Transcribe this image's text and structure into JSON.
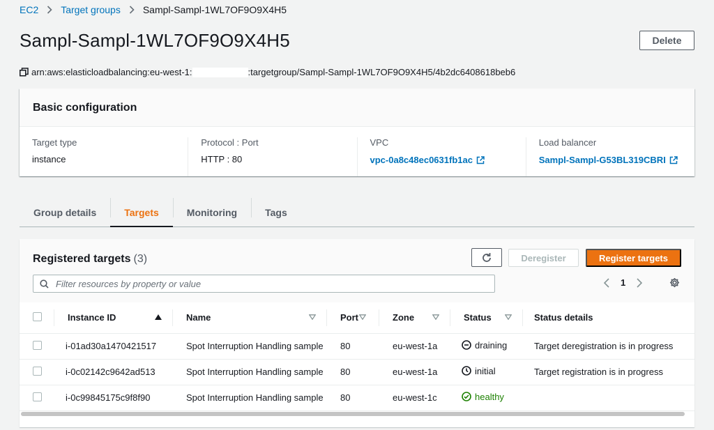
{
  "breadcrumb": {
    "ec2": "EC2",
    "target_groups": "Target groups",
    "current": "Sampl-Sampl-1WL7OF9O9X4H5"
  },
  "page": {
    "title": "Sampl-Sampl-1WL7OF9O9X4H5",
    "delete_label": "Delete",
    "arn_prefix": "arn:aws:elasticloadbalancing:eu-west-1:",
    "arn_suffix": ":targetgroup/Sampl-Sampl-1WL7OF9O9X4H5/4b2dc6408618beb6"
  },
  "basic_config": {
    "title": "Basic configuration",
    "target_type_label": "Target type",
    "target_type": "instance",
    "protocol_label": "Protocol : Port",
    "protocol": "HTTP : 80",
    "vpc_label": "VPC",
    "vpc": "vpc-0a8c48ec0631fb1ac",
    "lb_label": "Load balancer",
    "lb": "Sampl-Sampl-G53BL319CBRI"
  },
  "tabs": [
    "Group details",
    "Targets",
    "Monitoring",
    "Tags"
  ],
  "targets": {
    "title": "Registered targets",
    "count": "(3)",
    "deregister_label": "Deregister",
    "register_label": "Register targets",
    "filter_placeholder": "Filter resources by property or value",
    "page": "1",
    "columns": {
      "instance_id": "Instance ID",
      "name": "Name",
      "port": "Port",
      "zone": "Zone",
      "status": "Status",
      "status_details": "Status details"
    },
    "rows": [
      {
        "instance_id": "i-01ad30a1470421517",
        "name": "Spot Interruption Handling sample",
        "port": "80",
        "zone": "eu-west-1a",
        "status": "draining",
        "details": "Target deregistration is in progress"
      },
      {
        "instance_id": "i-0c02142c9642ad513",
        "name": "Spot Interruption Handling sample",
        "port": "80",
        "zone": "eu-west-1a",
        "status": "initial",
        "details": "Target registration is in progress"
      },
      {
        "instance_id": "i-0c99845175c9f8f90",
        "name": "Spot Interruption Handling sample",
        "port": "80",
        "zone": "eu-west-1c",
        "status": "healthy",
        "details": ""
      }
    ]
  },
  "colors": {
    "link": "#0073bb",
    "accent": "#ec7211",
    "healthy": "#1d8102"
  }
}
